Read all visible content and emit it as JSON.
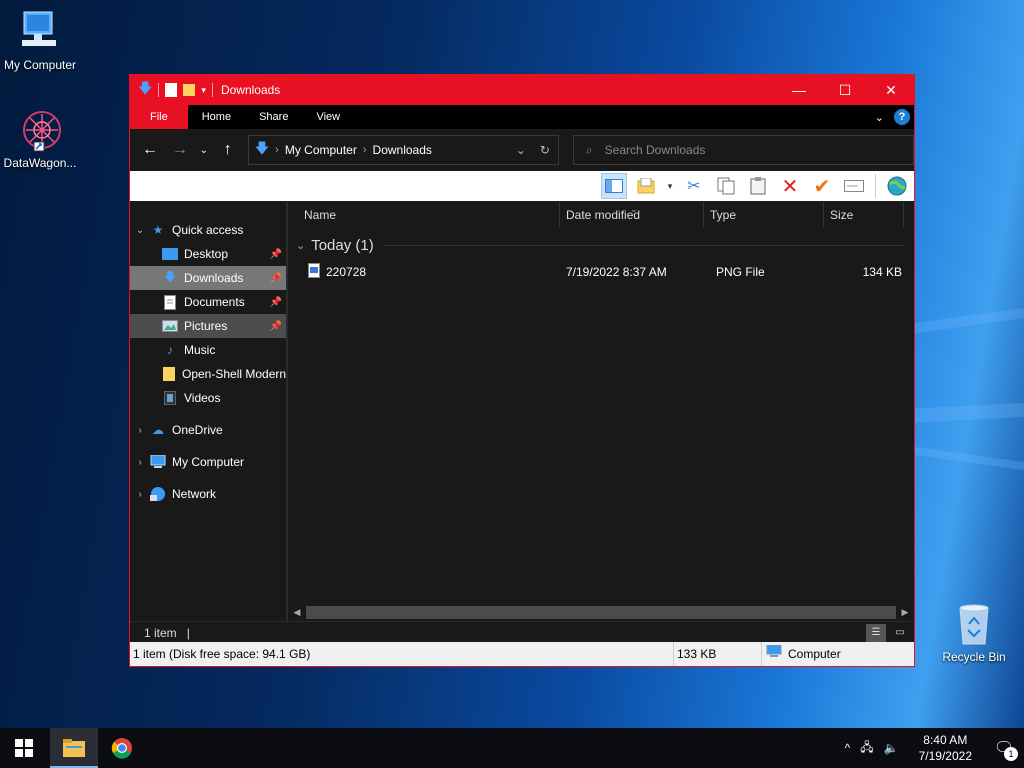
{
  "desktop": {
    "icons": [
      {
        "label": "My Computer"
      },
      {
        "label": "DataWagon..."
      },
      {
        "label": "Recycle Bin"
      }
    ]
  },
  "window": {
    "title": "Downloads",
    "tabs": [
      "File",
      "Home",
      "Share",
      "View"
    ],
    "address": {
      "root": "My Computer",
      "current": "Downloads"
    },
    "search_placeholder": "Search Downloads",
    "nav": {
      "quick_access": "Quick access",
      "quick_items": [
        "Desktop",
        "Downloads",
        "Documents",
        "Pictures",
        "Music",
        "Open-Shell Modern",
        "Videos"
      ],
      "onedrive": "OneDrive",
      "my_computer": "My Computer",
      "network": "Network"
    },
    "columns": {
      "name": "Name",
      "date": "Date modified",
      "type": "Type",
      "size": "Size"
    },
    "group": "Today (1)",
    "files": [
      {
        "name": "220728",
        "date": "7/19/2022 8:37 AM",
        "type": "PNG File",
        "size": "134 KB"
      }
    ],
    "status": {
      "count": "1 item",
      "cursor": "|"
    },
    "classic_status": {
      "info": "1 item (Disk free space: 94.1 GB)",
      "size": "133 KB",
      "location": "Computer"
    }
  },
  "taskbar": {
    "time": "8:40 AM",
    "date": "7/19/2022",
    "notifications": "1"
  },
  "colors": {
    "accent": "#e81123",
    "explorer_bg": "#191919",
    "selected": "#777777"
  }
}
